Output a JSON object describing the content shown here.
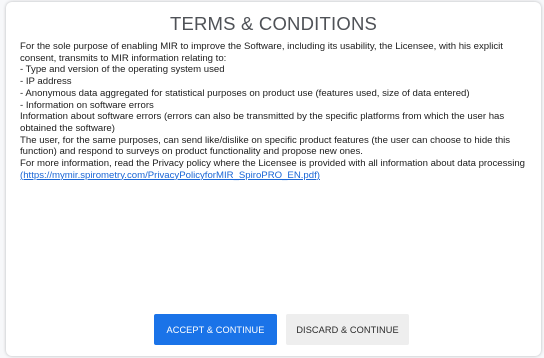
{
  "dialog": {
    "title": "TERMS & CONDITIONS",
    "paragraphs": [
      "For the sole purpose of enabling MIR to improve the Software, including its usability, the Licensee, with his explicit consent, transmits to MIR information relating to:",
      "- Type and version of the operating system used",
      "- IP address",
      "- Anonymous data aggregated for statistical purposes on product use (features used, size of data entered)",
      "- Information on software errors",
      "Information about software errors (errors can also be transmitted by the specific platforms from which the user has obtained the software)",
      "The user, for the same purposes, can send like/dislike on specific product features (the user can choose to hide this function) and respond to surveys on product functionality and propose new ones."
    ],
    "privacy_text": "For more information, read the Privacy policy where the Licensee is provided with all information about data processing",
    "privacy_link": "(https://mymir.spirometry.com/PrivacyPolicyforMIR_SpiroPRO_EN.pdf)",
    "accept_label": "ACCEPT & CONTINUE",
    "discard_label": "DISCARD & CONTINUE"
  },
  "colors": {
    "accent": "#1a73e8",
    "link": "#1a66d6",
    "title": "#4f5257"
  }
}
